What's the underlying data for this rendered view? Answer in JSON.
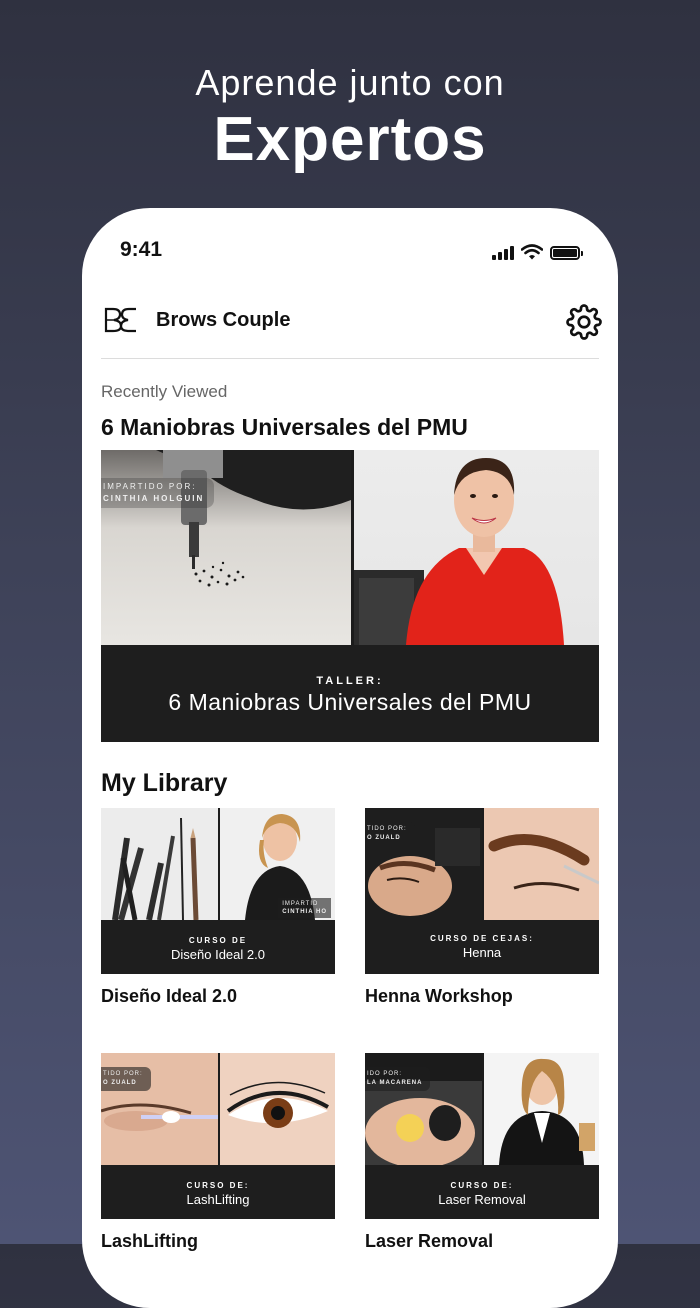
{
  "promo": {
    "line1": "Aprende junto con",
    "line2": "Expertos"
  },
  "status": {
    "time": "9:41"
  },
  "appbar": {
    "title": "Brows Couple"
  },
  "recent": {
    "label": "Recently Viewed",
    "title": "6 Maniobras Universales del PMU",
    "thumb": {
      "tag_line1": "IMPARTIDO POR:",
      "tag_line2": "CINTHIA HOLGUIN",
      "kicker": "TALLER:",
      "name": "6 Maniobras Universales del PMU"
    }
  },
  "library": {
    "title": "My Library",
    "items": [
      {
        "title": "Diseño Ideal 2.0",
        "kicker": "CURSO DE",
        "name": "Diseño Ideal 2.0",
        "tag_line1": "IMPARTID",
        "tag_line2": "CINTHIA HO"
      },
      {
        "title": "Henna Workshop",
        "kicker": "CURSO DE CEJAS:",
        "name": "Henna",
        "tag_line1": "TIDO POR:",
        "tag_line2": "O ZUALD"
      },
      {
        "title": "LashLifting",
        "kicker": "CURSO DE:",
        "name": "LashLifting",
        "tag_line1": "TIDO POR:",
        "tag_line2": "O ZUALD"
      },
      {
        "title": "Laser Removal",
        "kicker": "CURSO DE:",
        "name": "Laser Removal",
        "tag_line1": "IDO POR:",
        "tag_line2": "LA MACARENA"
      }
    ]
  }
}
